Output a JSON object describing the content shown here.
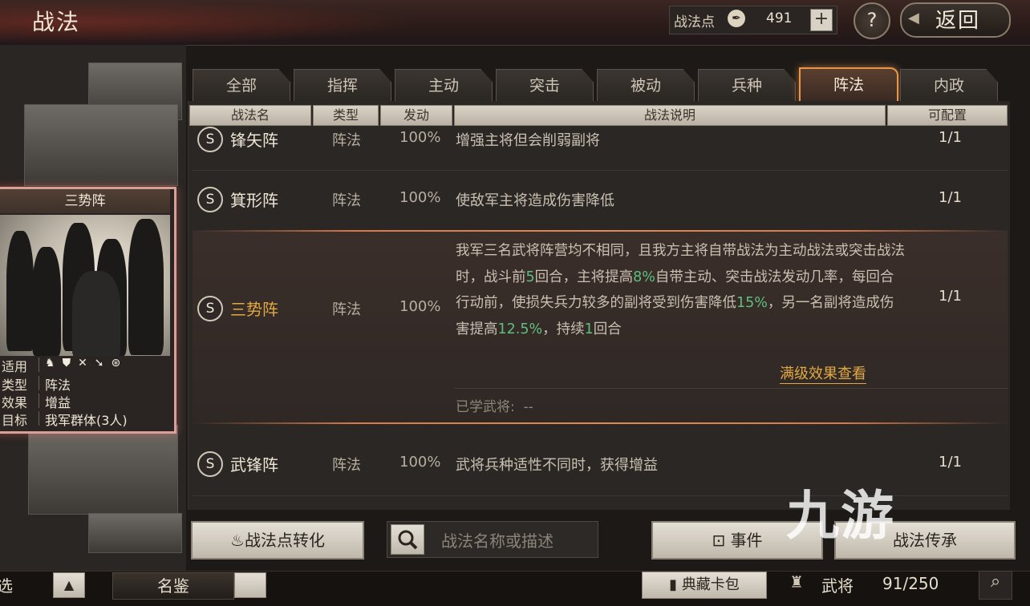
{
  "header": {
    "title": "战法",
    "points_label": "战法点",
    "points_value": "491",
    "add_label": "+",
    "help_label": "?",
    "back_label": "返回"
  },
  "tabs": [
    {
      "label": "全部",
      "active": false
    },
    {
      "label": "指挥",
      "active": false
    },
    {
      "label": "主动",
      "active": false
    },
    {
      "label": "突击",
      "active": false
    },
    {
      "label": "被动",
      "active": false
    },
    {
      "label": "兵种",
      "active": false
    },
    {
      "label": "阵法",
      "active": true
    },
    {
      "label": "内政",
      "active": false
    }
  ],
  "columns": [
    "战法名",
    "类型",
    "发动",
    "战法说明",
    "可配置"
  ],
  "rows": [
    {
      "grade": "S",
      "name": "锋矢阵",
      "type": "阵法",
      "rate": "100%",
      "desc": "增强主将但会削弱副将",
      "config": "1/1"
    },
    {
      "grade": "S",
      "name": "箕形阵",
      "type": "阵法",
      "rate": "100%",
      "desc": "使敌军主将造成伤害降低",
      "config": "1/1"
    },
    {
      "grade": "S",
      "name": "三势阵",
      "type": "阵法",
      "rate": "100%",
      "config": "1/1",
      "desc_parts": [
        "我军三名武将阵营均不相同，且我方主将自带战法为主动战法或突击战法时，战斗前",
        "5",
        "回合，主将提高",
        "8%",
        "自带主动、突击战法发动几率，每回合行动前，使损失兵力较多的副将受到伤害降低",
        "15%",
        "，另一名副将造成伤害提高",
        "12.5%",
        "，持续",
        "1",
        "回合"
      ],
      "max_effect_link": "满级效果查看",
      "learned_label": "已学武将:",
      "learned_value": "--"
    },
    {
      "grade": "S",
      "name": "武锋阵",
      "type": "阵法",
      "rate": "100%",
      "desc": "武将兵种适性不同时，获得增益",
      "config": "1/1"
    }
  ],
  "card": {
    "title": "三势阵",
    "applicable_label": "适用",
    "type_label": "类型",
    "type_value": "阵法",
    "effect_label": "效果",
    "effect_value": "增益",
    "target_label": "目标",
    "target_value": "我军群体(3人)"
  },
  "toolbar": {
    "convert_label": "战法点转化",
    "search_placeholder": "战法名称或描述",
    "event_label": "事件",
    "inherit_label": "战法传承"
  },
  "bottombar": {
    "left_label": "选",
    "mingjian_label": "名鉴",
    "collection_label": "典藏卡包",
    "general_label": "武将",
    "general_count": "91/250"
  },
  "watermark": "九游",
  "colors": {
    "highlight": "#5fbf7f",
    "link": "#e2a843",
    "active_tab_border": "#e9964b"
  }
}
